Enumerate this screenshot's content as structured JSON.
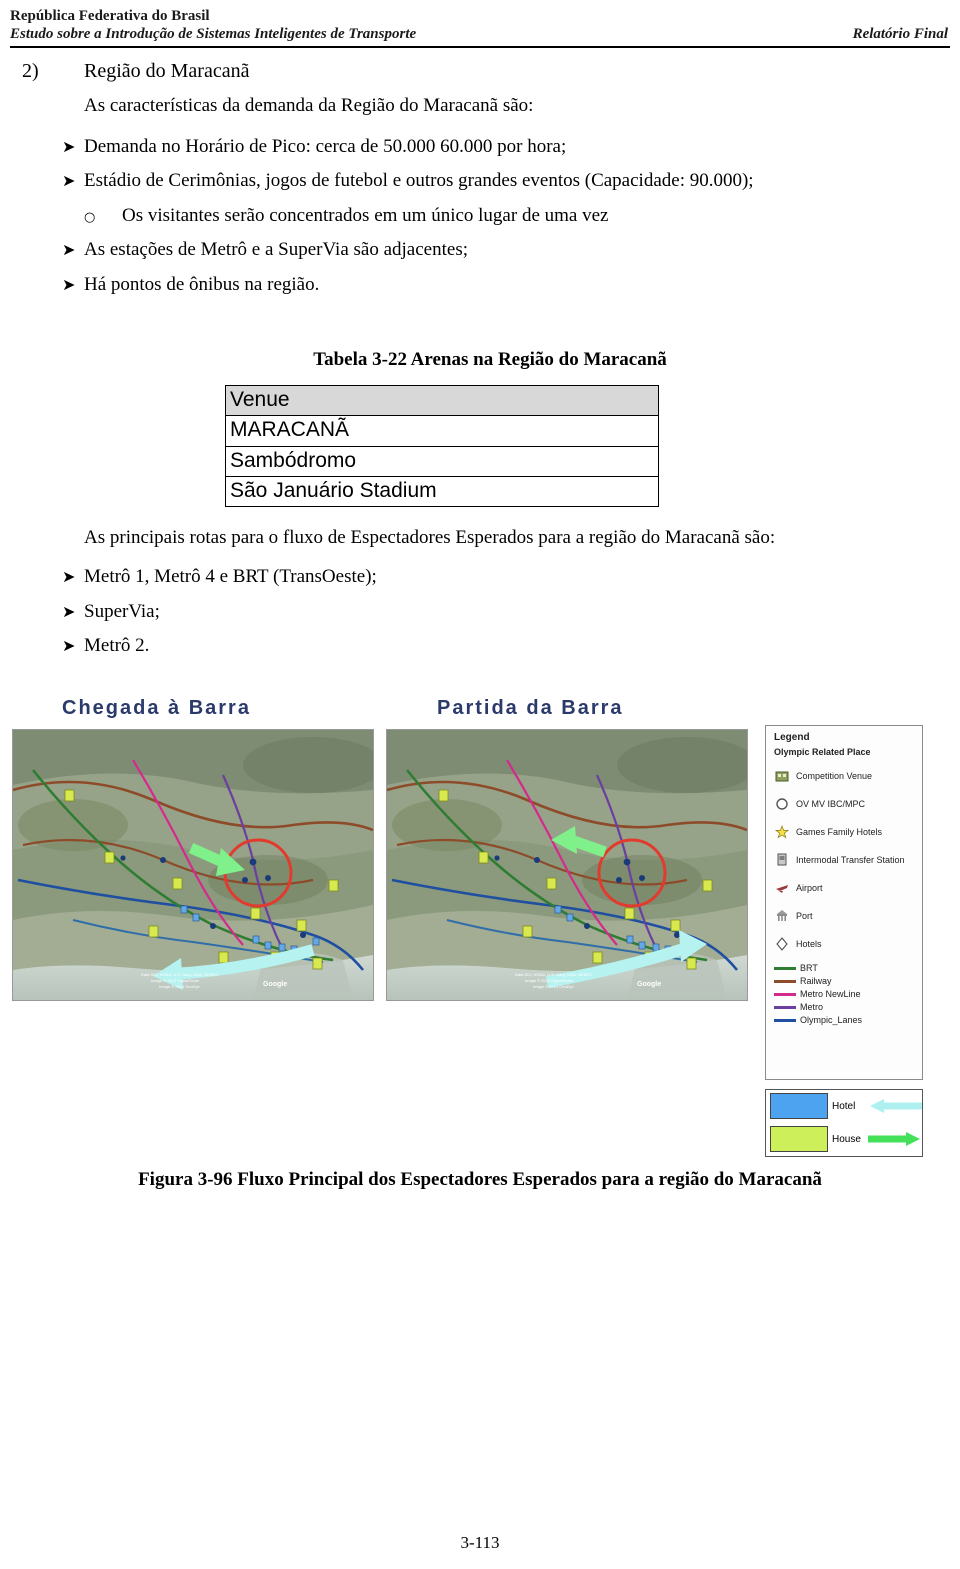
{
  "header": {
    "line1": "República Federativa do Brasil",
    "line2_left": "Estudo sobre a Introdução de Sistemas Inteligentes de Transporte",
    "line2_right": "Relatório Final"
  },
  "section": {
    "number": "2)",
    "title": "Região do Maracanã",
    "intro": "As características da demanda da Região do Maracanã são:",
    "bullets": [
      {
        "mark": "arrow",
        "text": "Demanda no Horário de Pico: cerca de 50.000  60.000 por hora;"
      },
      {
        "mark": "arrow",
        "text": "Estádio de Cerimônias, jogos de futebol e outros grandes eventos (Capacidade: 90.000);"
      },
      {
        "mark": "circle",
        "text": "Os visitantes serão concentrados em um único lugar de uma vez"
      },
      {
        "mark": "arrow",
        "text": "As estações de Metrô e a SuperVia são adjacentes;"
      },
      {
        "mark": "arrow",
        "text": "Há pontos de ônibus na região."
      }
    ]
  },
  "table": {
    "caption": "Tabela 3-22 Arenas na Região do Maracanã",
    "header": "Venue",
    "rows": [
      "MARACANÃ",
      "Sambódromo",
      "São Januário Stadium"
    ]
  },
  "routes": {
    "intro": "As principais rotas para o fluxo de Espectadores Esperados para a região do Maracanã são:",
    "bullets": [
      "Metrô 1, Metrô 4 e BRT (TransOeste);",
      "SuperVia;",
      "Metrô 2."
    ]
  },
  "figure": {
    "label_left": "Chegada à Barra",
    "label_right": "Partida da Barra",
    "caption": "Figura 3-96 Fluxo Principal dos Espectadores Esperados para a região do Maracanã",
    "map_attribution": "Google",
    "map_credit": "Data SIO, NOAA, U.S. Navy, NGA, GEBCO\nImage © 2013 DigitalGlobe\nImage © 2013 GeoEye",
    "legend": {
      "title": "Legend",
      "subtitle": "Olympic Related Place",
      "places": [
        {
          "icon": "competition-venue-icon",
          "label": "Competition Venue"
        },
        {
          "icon": "ov-mv-ibc-mpc-icon",
          "label": "OV MV IBC/MPC"
        },
        {
          "icon": "games-family-hotels-icon",
          "label": "Games Family Hotels"
        },
        {
          "icon": "intermodal-transfer-station-icon",
          "label": "Intermodal Transfer Station"
        },
        {
          "icon": "airport-icon",
          "label": "Airport"
        },
        {
          "icon": "port-icon",
          "label": "Port"
        },
        {
          "icon": "hotels-icon",
          "label": "Hotels"
        }
      ],
      "lines": [
        {
          "label": "BRT",
          "color": "#2e7d32"
        },
        {
          "label": "Railway",
          "color": "#8d4b2a"
        },
        {
          "label": "Metro NewLine",
          "color": "#d42a8c"
        },
        {
          "label": "Metro",
          "color": "#6b3fa0"
        },
        {
          "label": "Olympic_Lanes",
          "color": "#1f4fa0"
        }
      ],
      "arrows": [
        {
          "label": "Hotel",
          "chip_color": "#4da3f0",
          "arrow_color": "#aef0ef"
        },
        {
          "label": "House",
          "chip_color": "#cdf05a",
          "arrow_color": "#44e05a"
        }
      ]
    }
  },
  "footer": {
    "page": "3-113"
  },
  "colors": {
    "table_header_bg": "#d8d8d8",
    "label_blue": "#2b3a6b",
    "highlight_circle": "#e23b2e"
  }
}
